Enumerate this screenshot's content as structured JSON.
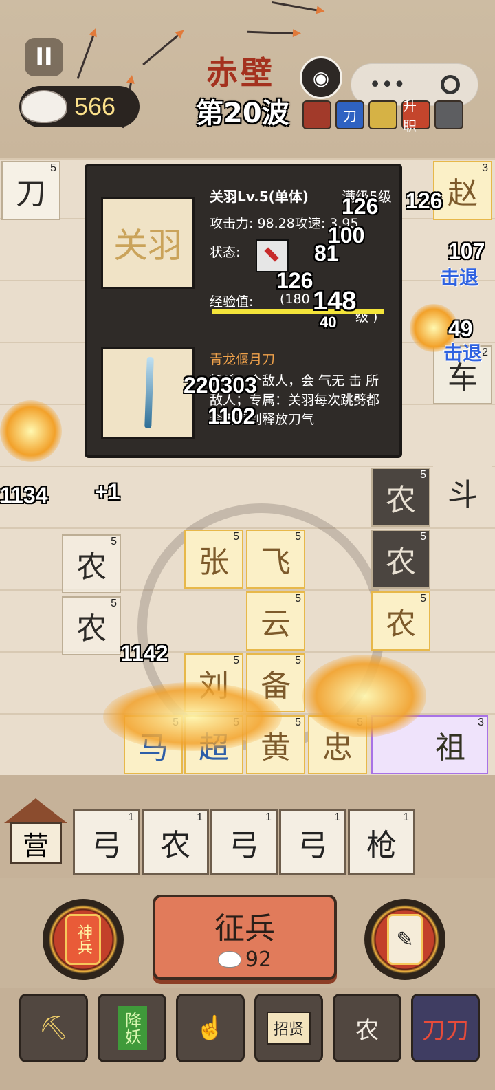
{
  "top": {
    "coins": "566",
    "stage": "赤壁",
    "wave": "第20波",
    "buffs": [
      "",
      "刀",
      "",
      "升职",
      ""
    ]
  },
  "panel": {
    "portrait_text": "关羽",
    "name": "关羽Lv.5(单体)",
    "max_level": "满级5级",
    "stats": "攻击力: 98.28攻速: 3.95",
    "state_label": "状态:",
    "exp_label": "经验值:",
    "exp_value": "(180",
    "exp_suffix": "级 )",
    "exp_fraction": 1.0,
    "weapon_name": "青龙偃月刀",
    "description": "斩杀一个敌人，会 气无 击 所 敌人；专属：关羽每次跳劈都会无差别释放刀气"
  },
  "board": {
    "tiles": [
      {
        "text": "刀",
        "lv": "5"
      },
      {
        "text": "赵",
        "lv": "3"
      },
      {
        "text": "农",
        "lv": "5"
      },
      {
        "text": "农",
        "lv": "5"
      },
      {
        "text": "农",
        "lv": "5"
      },
      {
        "text": "农",
        "lv": "5"
      },
      {
        "text": "农",
        "lv": "5"
      },
      {
        "text": "张",
        "lv": "5"
      },
      {
        "text": "飞",
        "lv": "5"
      },
      {
        "text": "云",
        "lv": "5"
      },
      {
        "text": "刘",
        "lv": "5"
      },
      {
        "text": "备",
        "lv": "5"
      },
      {
        "text": "马",
        "lv": "5"
      },
      {
        "text": "超",
        "lv": "5"
      },
      {
        "text": "黄",
        "lv": "5"
      },
      {
        "text": "忠",
        "lv": "5"
      },
      {
        "text": "祖",
        "lv": "3"
      },
      {
        "text": "车",
        "lv": "2"
      },
      {
        "text": "斗",
        "lv": ""
      }
    ],
    "damage": [
      "126",
      "100",
      "81",
      "126",
      "148",
      "40",
      "49",
      "107",
      "220303",
      "1102",
      "1134",
      "1142",
      "+1"
    ],
    "knockback": "击退"
  },
  "bench": {
    "camp": "营",
    "tiles": [
      {
        "text": "弓",
        "lv": "1"
      },
      {
        "text": "农",
        "lv": "1"
      },
      {
        "text": "弓",
        "lv": "1"
      },
      {
        "text": "弓",
        "lv": "1"
      },
      {
        "text": "枪",
        "lv": "1"
      }
    ]
  },
  "actions": {
    "divine_weapon": "神兵",
    "recruit": "征兵",
    "recruit_cost": "92"
  },
  "tools": {
    "items": [
      "",
      "降妖",
      "",
      "招贤",
      "农",
      "刀刀"
    ]
  }
}
